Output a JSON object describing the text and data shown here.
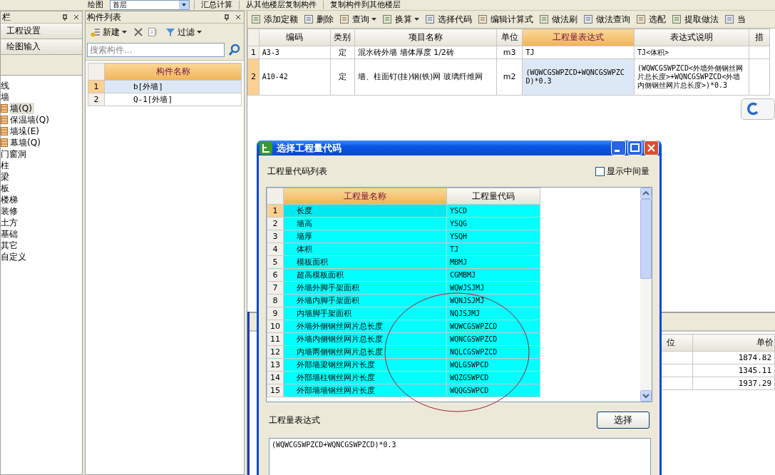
{
  "top_toolbar": [
    {
      "kind": "button",
      "label": "绘图"
    },
    {
      "kind": "dropdown",
      "label": "首层"
    },
    {
      "kind": "button",
      "label": "汇总计算"
    },
    {
      "kind": "button",
      "label": "从其他楼层复制构件"
    },
    {
      "kind": "button",
      "label": "复制构件到其他楼层"
    }
  ],
  "nav_panel": {
    "title": "栏",
    "buttons": [
      "工程设置",
      "绘图输入"
    ],
    "tree": [
      {
        "label": "线",
        "selected": false
      },
      {
        "label": "墙",
        "selected": false,
        "children": [
          {
            "label": "墙(Q)",
            "selected": true
          },
          {
            "label": "保温墙(Q)",
            "selected": false
          },
          {
            "label": "墙垛(E)",
            "selected": false
          },
          {
            "label": "幕墙(Q)",
            "selected": false
          }
        ]
      },
      {
        "label": "门窗洞",
        "selected": false
      },
      {
        "label": "柱",
        "selected": false
      },
      {
        "label": "梁",
        "selected": false
      },
      {
        "label": "板",
        "selected": false
      },
      {
        "label": "楼梯",
        "selected": false
      },
      {
        "label": "装修",
        "selected": false
      },
      {
        "label": "土方",
        "selected": false
      },
      {
        "label": "基础",
        "selected": false
      },
      {
        "label": "其它",
        "selected": false
      },
      {
        "label": "自定义",
        "selected": false
      }
    ]
  },
  "component_list": {
    "title": "构件列表",
    "toolbar": [
      {
        "kind": "new",
        "label": "新建",
        "dropdown": true
      },
      {
        "kind": "delete"
      },
      {
        "kind": "copy"
      },
      {
        "kind": "filter",
        "label": "过滤",
        "dropdown": true
      }
    ],
    "search": {
      "placeholder": "搜索构件..."
    },
    "column": "构件名称",
    "rows": [
      {
        "index": "1",
        "name": "b[外墙]",
        "selected": true
      },
      {
        "index": "2",
        "name": "Q-1[外墙]",
        "selected": false
      }
    ]
  },
  "method_toolbar": [
    {
      "label": "添加定额",
      "dropdown": false
    },
    {
      "label": "删除",
      "dropdown": false
    },
    {
      "label": "查询",
      "dropdown": true
    },
    {
      "label": "换算",
      "dropdown": true
    },
    {
      "label": "选择代码",
      "dropdown": false
    },
    {
      "label": "编辑计算式",
      "dropdown": false
    },
    {
      "label": "做法刷",
      "dropdown": false
    },
    {
      "label": "做法查询",
      "dropdown": false
    },
    {
      "label": "选配",
      "dropdown": false
    },
    {
      "label": "提取做法",
      "dropdown": false
    },
    {
      "label": "当",
      "dropdown": false
    }
  ],
  "method_table": {
    "columns": [
      {
        "label": "编码",
        "selected": false
      },
      {
        "label": "类别",
        "selected": false
      },
      {
        "label": "项目名称",
        "selected": false
      },
      {
        "label": "单位",
        "selected": false
      },
      {
        "label": "工程量表达式",
        "selected": true
      },
      {
        "label": "表达式说明",
        "selected": false
      },
      {
        "label": "措",
        "selected": false
      }
    ],
    "rows": [
      {
        "index": "1",
        "selected": false,
        "cells": [
          "A3-3",
          "定",
          "混水砖外墙 墙体厚度 1/2砖",
          "m3",
          "TJ",
          "TJ<体积>",
          ""
        ]
      },
      {
        "index": "2",
        "selected": true,
        "cells": [
          "A10-42",
          "定",
          "墙、柱面钉(挂)钢(铁)网 玻璃纤维网",
          "m2",
          "(WQWCGSWPZCD+WQNCGSWPZCD)*0.3",
          "(WQWCGSWPZCD<外墙外侧钢丝网片总长度>+WQNCGSWPZCD<外墙内侧钢丝网片总长度>)*0.3",
          ""
        ]
      }
    ]
  },
  "price_table": {
    "columns": [
      "位",
      "单价"
    ],
    "rows": [
      [
        "",
        "1874.82"
      ],
      [
        "",
        "1345.11"
      ],
      [
        "",
        "1937.29"
      ]
    ]
  },
  "dialog": {
    "title": "选择工程量代码",
    "list_label": "工程量代码列表",
    "show_intermediate": {
      "label": "显示中间量",
      "checked": false
    },
    "columns": [
      {
        "label": "工程量名称",
        "selected": true
      },
      {
        "label": "工程量代码",
        "selected": false
      }
    ],
    "rows": [
      {
        "index": "1",
        "name": "长度",
        "code": "YSCD",
        "selected": true
      },
      {
        "index": "2",
        "name": "墙高",
        "code": "YSQG",
        "selected": false
      },
      {
        "index": "3",
        "name": "墙厚",
        "code": "YSQH",
        "selected": false
      },
      {
        "index": "4",
        "name": "体积",
        "code": "TJ",
        "selected": false
      },
      {
        "index": "5",
        "name": "模板面积",
        "code": "MBMJ",
        "selected": false
      },
      {
        "index": "6",
        "name": "超高模板面积",
        "code": "CGMBMJ",
        "selected": false
      },
      {
        "index": "7",
        "name": "外墙外脚手架面积",
        "code": "WQWJSJMJ",
        "selected": false
      },
      {
        "index": "8",
        "name": "外墙内脚手架面积",
        "code": "WQNJSJMJ",
        "selected": false
      },
      {
        "index": "9",
        "name": "内墙脚手架面积",
        "code": "NQJSJMJ",
        "selected": false
      },
      {
        "index": "10",
        "name": "外墙外侧钢丝网片总长度",
        "code": "WQWCGSWPZCD",
        "selected": false
      },
      {
        "index": "11",
        "name": "外墙内侧钢丝网片总长度",
        "code": "WQNCGSWPZCD",
        "selected": false
      },
      {
        "index": "12",
        "name": "内墙两侧钢丝网片总长度",
        "code": "NQLCGSWPZCD",
        "selected": false
      },
      {
        "index": "13",
        "name": "外部墙梁钢丝网片长度",
        "code": "WQLGSWPCD",
        "selected": false
      },
      {
        "index": "14",
        "name": "外部墙柱钢丝网片长度",
        "code": "WQZGSWPCD",
        "selected": false
      },
      {
        "index": "15",
        "name": "外部墙墙钢丝网片长度",
        "code": "WQQGSWPCD",
        "selected": false
      }
    ],
    "expression_label": "工程量表达式",
    "select_button": "选择",
    "expression": "(WQWCGSWPZCD+WQNCGSWPZCD)*0.3"
  }
}
